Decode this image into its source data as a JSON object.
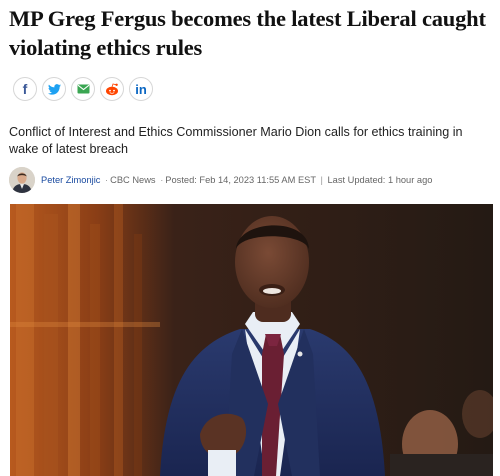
{
  "article": {
    "headline": "MP Greg Fergus becomes the latest Liberal caught violating ethics rules",
    "deck": "Conflict of Interest and Ethics Commissioner Mario Dion calls for ethics training in wake of latest breach"
  },
  "share": {
    "buttons": [
      {
        "icon": "facebook-icon",
        "color": "#3b5998"
      },
      {
        "icon": "twitter-icon",
        "color": "#1da1f2"
      },
      {
        "icon": "email-icon",
        "color": "#3aa652"
      },
      {
        "icon": "reddit-icon",
        "color": "#ff4500"
      },
      {
        "icon": "linkedin-icon",
        "color": "#0a66c2"
      }
    ]
  },
  "byline": {
    "author": "Peter Zimonjic",
    "source": "CBC News",
    "posted": "Posted: Feb 14, 2023 11:55 AM EST",
    "updated": "Last Updated: 1 hour ago"
  },
  "colors": {
    "headline": "#111111",
    "author_link": "#1a4ba0",
    "meta_text": "#666666"
  }
}
